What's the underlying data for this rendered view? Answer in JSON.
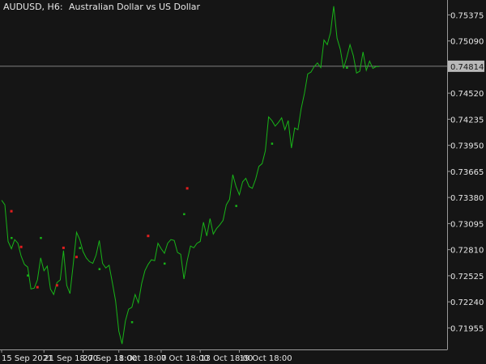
{
  "chart_title": {
    "symbol_timeframe": "AUDUSD, H6:",
    "description": "Australian Dollar vs US Dollar"
  },
  "colors": {
    "background": "#151515",
    "axis": "#9a9a9a",
    "text": "#e6e6e6",
    "line": "#18b418",
    "dot_up": "#18b418",
    "dot_down": "#e01e1e",
    "current_price_line": "#808080",
    "current_price_box": "#b8b8b8"
  },
  "chart_data": {
    "type": "line",
    "title": "AUDUSD, H6:  Australian Dollar vs US Dollar",
    "xlabel": "",
    "ylabel": "",
    "ylim": [
      0.7172,
      0.7552
    ],
    "y_ticks": [
      0.75375,
      0.7509,
      0.74814,
      0.7452,
      0.74235,
      0.7395,
      0.73665,
      0.7338,
      0.73095,
      0.7281,
      0.72525,
      0.7224,
      0.71955
    ],
    "y_tick_labels": [
      "0.75375",
      "0.75090",
      "0.74814",
      "0.74520",
      "0.74235",
      "0.73950",
      "0.73665",
      "0.73380",
      "0.73095",
      "0.72810",
      "0.72525",
      "0.72240",
      "0.71955"
    ],
    "x_tick_labels": [
      "15 Sep 2021",
      "21 Sep 18:00",
      "27 Sep 18:00",
      "1 Oct 18:00",
      "7 Oct 18:00",
      "13 Oct 18:00",
      "19 Oct 18:00"
    ],
    "x_tick_bars": [
      0,
      13,
      25,
      36,
      49,
      61,
      73
    ],
    "current_price": 0.74814,
    "grid": false,
    "series": [
      {
        "values": [
          0.7335,
          0.733,
          0.729,
          0.7282,
          0.7292,
          0.7288,
          0.7274,
          0.7265,
          0.7262,
          0.7238,
          0.7239,
          0.7248,
          0.7272,
          0.7258,
          0.7263,
          0.7238,
          0.7232,
          0.7245,
          0.7248,
          0.728,
          0.7242,
          0.7233,
          0.7265,
          0.73,
          0.7292,
          0.7279,
          0.7272,
          0.7268,
          0.7266,
          0.7275,
          0.7291,
          0.7266,
          0.7261,
          0.7264,
          0.7245,
          0.7225,
          0.7192,
          0.7178,
          0.7203,
          0.7216,
          0.7218,
          0.7232,
          0.7223,
          0.7244,
          0.7258,
          0.7265,
          0.727,
          0.7269,
          0.7288,
          0.7282,
          0.7277,
          0.7288,
          0.7292,
          0.7291,
          0.7278,
          0.7276,
          0.7249,
          0.7269,
          0.7285,
          0.7283,
          0.7288,
          0.729,
          0.7311,
          0.7296,
          0.7315,
          0.7298,
          0.7304,
          0.7308,
          0.7313,
          0.733,
          0.7336,
          0.7363,
          0.735,
          0.7341,
          0.7355,
          0.7359,
          0.735,
          0.7348,
          0.7358,
          0.7372,
          0.7375,
          0.7389,
          0.7426,
          0.7422,
          0.7416,
          0.742,
          0.7425,
          0.7412,
          0.7422,
          0.7392,
          0.7414,
          0.7412,
          0.7435,
          0.7452,
          0.7473,
          0.7475,
          0.7481,
          0.7485,
          0.748,
          0.751,
          0.7505,
          0.7518,
          0.7547,
          0.7512,
          0.75,
          0.7479,
          0.7491,
          0.7505,
          0.7493,
          0.7474,
          0.7476,
          0.7497,
          0.7477,
          0.7487,
          0.7479,
          0.7481,
          0.7481
        ]
      }
    ],
    "signal_dots": {
      "up": [
        [
          3,
          0.7294
        ],
        [
          8,
          0.7253
        ],
        [
          12,
          0.7294
        ],
        [
          24,
          0.7283
        ],
        [
          30,
          0.726
        ],
        [
          40,
          0.7202
        ],
        [
          50,
          0.7266
        ],
        [
          56,
          0.732
        ],
        [
          72,
          0.7329
        ],
        [
          83,
          0.7397
        ],
        [
          106,
          0.748
        ]
      ],
      "down": [
        [
          3,
          0.7323
        ],
        [
          6,
          0.7284
        ],
        [
          11,
          0.724
        ],
        [
          17,
          0.7242
        ],
        [
          19,
          0.7283
        ],
        [
          23,
          0.7273
        ],
        [
          45,
          0.7296
        ],
        [
          57,
          0.7348
        ]
      ]
    }
  }
}
